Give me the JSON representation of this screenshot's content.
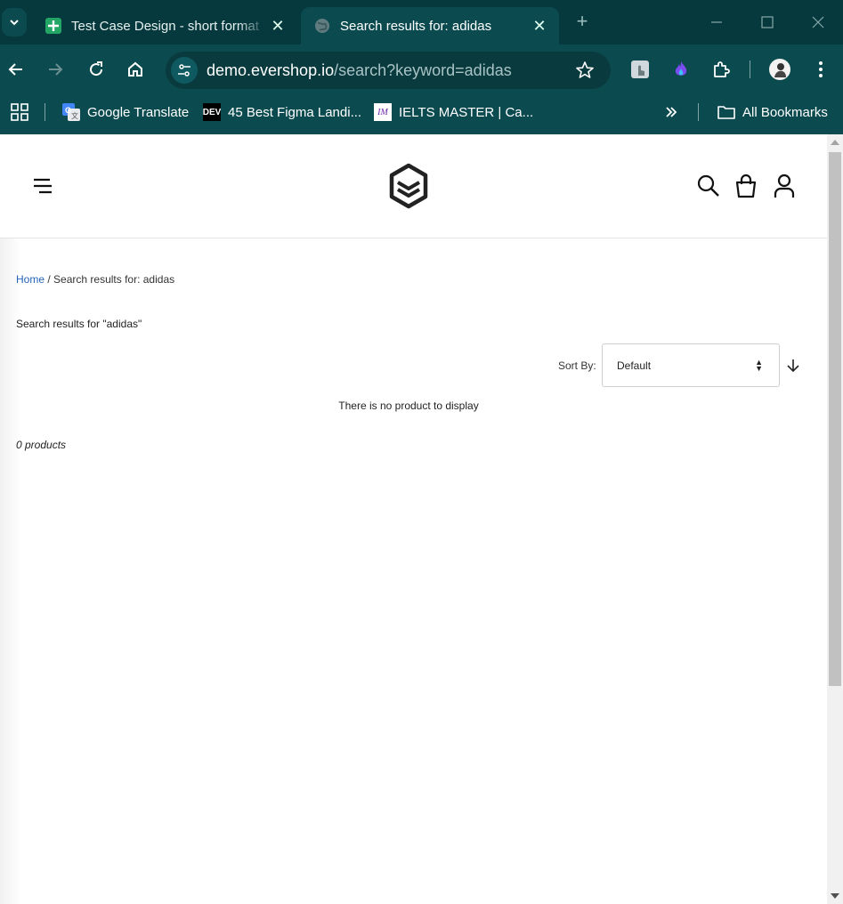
{
  "browser": {
    "tabs": [
      {
        "title": "Test Case Design - short format",
        "favicon": "google-sheets-icon",
        "active": false
      },
      {
        "title": "Search results for: adidas",
        "favicon": "globe-icon",
        "active": true
      }
    ],
    "url": {
      "host": "demo.evershop.io",
      "path": "/search?keyword=adidas"
    },
    "bookmarks": [
      {
        "label": "Google Translate",
        "icon": "google-translate-icon"
      },
      {
        "label": "45 Best Figma Landi...",
        "icon": "dev-icon"
      },
      {
        "label": "IELTS MASTER | Ca...",
        "icon": "im-icon"
      }
    ],
    "all_bookmarks": "All Bookmarks",
    "dev_badge": "DEV",
    "im_badge": "IM"
  },
  "page": {
    "breadcrumb": {
      "home": "Home",
      "separator": "/",
      "current": "Search results for: adidas"
    },
    "heading": "Search results for \"adidas\"",
    "sort": {
      "label": "Sort By:",
      "value": "Default"
    },
    "empty_message": "There is no product to display",
    "product_count": "0 products"
  },
  "colors": {
    "browser_frame": "#06393d",
    "toolbar": "#0b4b50",
    "link": "#2563b8"
  }
}
